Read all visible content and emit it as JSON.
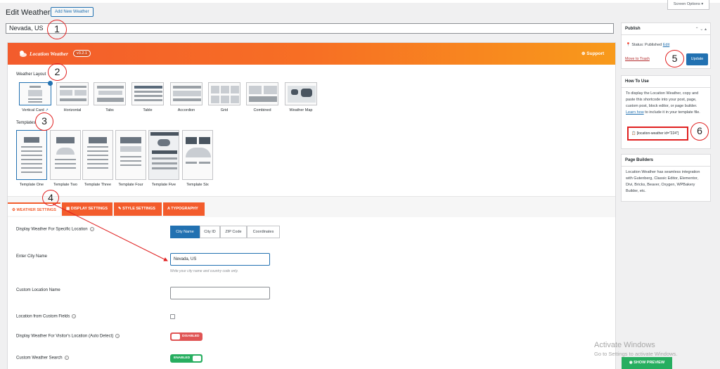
{
  "header": {
    "title": "Edit Weather",
    "add_new": "Add New Weather",
    "screen_options": "Screen Options ▾"
  },
  "post_title": "Nevada, US",
  "banner": {
    "logo": "Location Weather",
    "version": "v3.2.1",
    "support": "Support"
  },
  "layouts": {
    "label": "Weather Layout",
    "items": [
      "Vertical Card",
      "Horizontal",
      "Tabs",
      "Table",
      "Accordion",
      "Grid",
      "Combined",
      "Weather Map"
    ]
  },
  "templates": {
    "label": "Templates",
    "items": [
      "Template One",
      "Template Two",
      "Template Three",
      "Template Four",
      "Template Five",
      "Template Six"
    ]
  },
  "tabs": [
    "WEATHER SETTINGS",
    "DISPLAY SETTINGS",
    "STYLE SETTINGS",
    "TYPOGRAPHY"
  ],
  "fields": {
    "location_type_label": "Display Weather For Specific Location",
    "location_options": [
      "City Name",
      "City ID",
      "ZIP Code",
      "Coordinates"
    ],
    "city_label": "Enter City Name",
    "city_value": "Nevada, US",
    "city_hint": "Write your city name and country code only.",
    "custom_location_label": "Custom Location Name",
    "custom_fields_label": "Location from Custom Fields",
    "visitor_label": "Display Weather For Visitor's Location (Auto Detect)",
    "visitor_toggle": "DISABLED",
    "search_label": "Custom Weather Search",
    "search_toggle": "ENABLED"
  },
  "publish": {
    "title": "Publish",
    "status_label": "Status:",
    "status_value": "Published",
    "edit": "Edit",
    "trash": "Move to Trash",
    "update": "Update"
  },
  "how_to_use": {
    "title": "How To Use",
    "text1": "To display the Location Weather, copy and paste this shortcode into your post, page, custom post, block editor, or page builder.",
    "learn_how": "Learn how",
    "text2": "to include it in your template file.",
    "shortcode": "[location-weather id=\"224\"]"
  },
  "page_builders": {
    "title": "Page Builders",
    "text": "Location Weather has seamless integration with Gutenberg, Classic Editor, Elementor, Divi, Bricks, Beaver, Oxygen, WPBakery Builder, etc."
  },
  "preview": "SHOW PREVIEW",
  "watermark": {
    "line1": "Activate Windows",
    "line2": "Go to Settings to activate Windows."
  },
  "markers": [
    "1",
    "2",
    "3",
    "4",
    "5",
    "6"
  ],
  "colors": {
    "accent": "#2271b1",
    "brand": "#f35c2c",
    "annotation": "#e02020",
    "enabled": "#27ae60",
    "disabled": "#e05555"
  }
}
